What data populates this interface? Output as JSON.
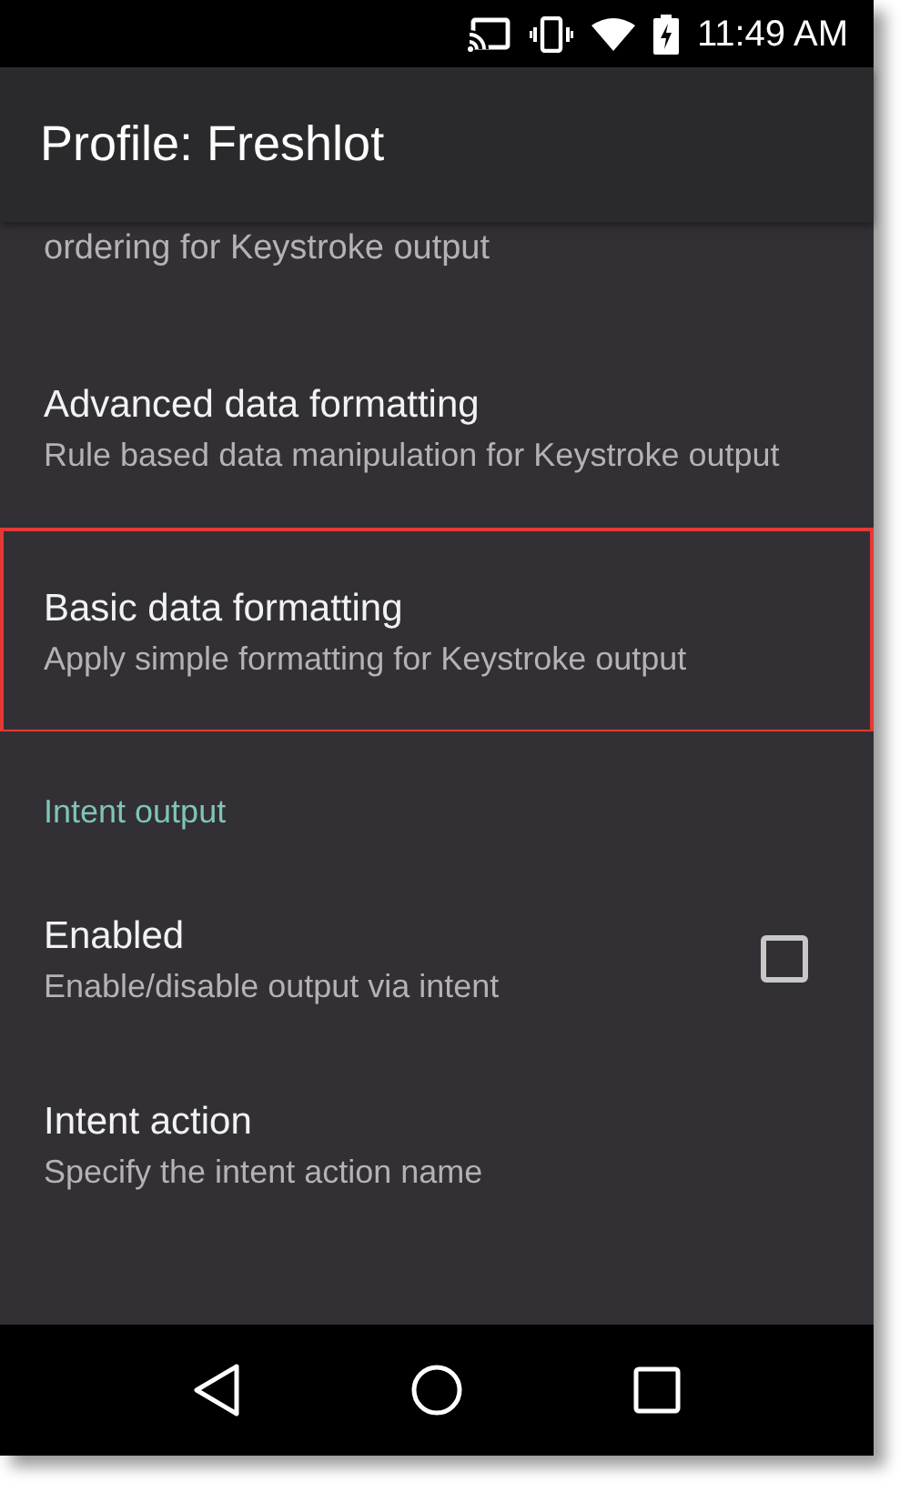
{
  "status_bar": {
    "time": "11:49 AM"
  },
  "app_bar": {
    "title": "Profile: Freshlot"
  },
  "items": [
    {
      "kind": "partial",
      "summary": "ordering for Keystroke output",
      "highlighted": false
    },
    {
      "kind": "preference",
      "title": "Advanced data formatting",
      "summary": "Rule based data manipulation for Keystroke output",
      "highlighted": false
    },
    {
      "kind": "preference",
      "title": "Basic data formatting",
      "summary": "Apply simple formatting for Keystroke output",
      "highlighted": true
    },
    {
      "kind": "category",
      "title": "Intent output"
    },
    {
      "kind": "checkbox",
      "title": "Enabled",
      "summary": "Enable/disable output via intent",
      "checked": false,
      "highlighted": false
    },
    {
      "kind": "preference",
      "title": "Intent action",
      "summary": "Specify the intent action name",
      "highlighted": false
    },
    {
      "kind": "empty"
    }
  ]
}
